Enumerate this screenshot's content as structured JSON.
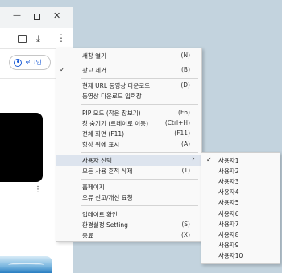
{
  "browser": {
    "window_controls": {
      "minimize": "—",
      "close": "✕"
    },
    "toolbar_icons": [
      "cast-icon",
      "download-icon",
      "more-icon"
    ],
    "download_glyph": "⤓",
    "more_glyph": "⋮",
    "login_label": "로그인",
    "video_more_glyph": "⋮"
  },
  "menu": {
    "items": [
      {
        "label": "새창 열기",
        "shortcut": "(N)",
        "checked": false
      },
      {
        "label": "광고 제거",
        "shortcut": "(B)",
        "checked": true
      },
      {
        "label": "현재 URL 동영상 다운로드",
        "shortcut": "(D)",
        "checked": false
      },
      {
        "label": "동영상 다운로드 입력창",
        "shortcut": "",
        "checked": false
      },
      {
        "label": "PIP 모드 (작은 창보기)",
        "shortcut": "(F6)",
        "checked": false
      },
      {
        "label": "창 숨기기 (트레이로 이동)",
        "shortcut": "(Ctrl+H)",
        "checked": false
      },
      {
        "label": "전체 화면 (F11)",
        "shortcut": "(F11)",
        "checked": false
      },
      {
        "label": "항상 위에 표시",
        "shortcut": "(A)",
        "checked": false
      },
      {
        "label": "사용자 선택",
        "shortcut": "",
        "checked": false,
        "submenu": true,
        "highlighted": true
      },
      {
        "label": "모든 사용 흔적 삭제",
        "shortcut": "(T)",
        "checked": false
      },
      {
        "label": "홈페이지",
        "shortcut": "",
        "checked": false
      },
      {
        "label": "오류 신고/개선 요청",
        "shortcut": "",
        "checked": false
      },
      {
        "label": "업데이트 확인",
        "shortcut": "",
        "checked": false
      },
      {
        "label": "환경설정 Setting",
        "shortcut": "(S)",
        "checked": false
      },
      {
        "label": "종료",
        "shortcut": "(X)",
        "checked": false
      }
    ],
    "check_glyph": "✓",
    "submenu_arrow": "›"
  },
  "submenu": {
    "items": [
      {
        "label": "사용자1",
        "checked": true
      },
      {
        "label": "사용자2",
        "checked": false
      },
      {
        "label": "사용자3",
        "checked": false
      },
      {
        "label": "사용자4",
        "checked": false
      },
      {
        "label": "사용자5",
        "checked": false
      },
      {
        "label": "사용자6",
        "checked": false
      },
      {
        "label": "사용자7",
        "checked": false
      },
      {
        "label": "사용자8",
        "checked": false
      },
      {
        "label": "사용자9",
        "checked": false
      },
      {
        "label": "사용자10",
        "checked": false
      }
    ]
  },
  "colors": {
    "highlight": "#dde4ee",
    "accent": "#1a5bd6",
    "desktop": "#c3d3de"
  }
}
